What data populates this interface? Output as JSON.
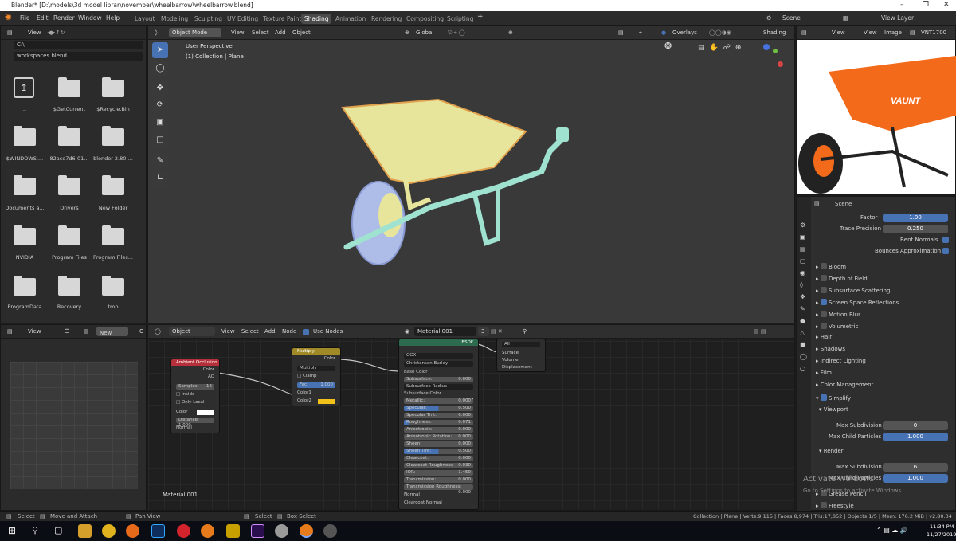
{
  "window": {
    "title": "Blender* [D:\\models\\3d model librar\\november\\wheelbarrow\\wheelbarrow.blend]"
  },
  "menu": [
    "File",
    "Edit",
    "Render",
    "Window",
    "Help"
  ],
  "workspaces": [
    "Layout",
    "Modeling",
    "Sculpting",
    "UV Editing",
    "Texture Paint",
    "Shading",
    "Animation",
    "Rendering",
    "Compositing",
    "Scripting"
  ],
  "active_workspace": "Shading",
  "scene": {
    "label": "Scene",
    "view_layer": "View Layer"
  },
  "filebrowser": {
    "view": "View",
    "path": "C:\\",
    "filename": "workspaces.blend",
    "items": [
      "..",
      "$GetCurrent",
      "$Recycle.Bin",
      "$WINDOWS....",
      "82ace7d6-01...",
      "blender-2.80-...",
      "Documents a...",
      "Drivers",
      "New Folder",
      "NVIDIA",
      "Program Files",
      "Program Files...",
      "ProgramData",
      "Recovery",
      "tmp"
    ]
  },
  "viewport": {
    "mode": "Object Mode",
    "menus": [
      "View",
      "Select",
      "Add",
      "Object"
    ],
    "orientation": "Global",
    "overlays": "Overlays",
    "shading": "Shading",
    "info_line1": "User Perspective",
    "info_line2": "(1) Collection | Plane"
  },
  "image_editor": {
    "view": "View",
    "view2": "View",
    "image": "Image",
    "name": "VNT1700",
    "brand": "VAUNT"
  },
  "properties": {
    "scene": "Scene",
    "factor_label": "Factor",
    "factor": "1.00",
    "trace_label": "Trace Precision",
    "trace": "0.250",
    "bent_normals": "Bent Normals",
    "bounces": "Bounces Approximation",
    "sections": [
      "Bloom",
      "Depth of Field",
      "Subsurface Scattering",
      "Screen Space Reflections",
      "Motion Blur",
      "Volumetric",
      "Hair",
      "Shadows",
      "Indirect Lighting",
      "Film",
      "Color Management",
      "Simplify"
    ],
    "viewport": "Viewport",
    "max_subdiv_label": "Max Subdivision",
    "max_subdiv_vp": "0",
    "max_child_label": "Max Child Particles",
    "max_child_vp": "1.000",
    "render": "Render",
    "max_subdiv_r": "6",
    "max_child_r": "1.000",
    "grease_pencil": "Grease Pencil",
    "freestyle": "Freestyle",
    "activate1": "Activate Windows",
    "activate2": "Go to Settings to activate Windows."
  },
  "image_panel": {
    "view": "View",
    "new": "New",
    "open": "O"
  },
  "node_editor": {
    "object": "Object",
    "menus": [
      "View",
      "Select",
      "Add",
      "Node"
    ],
    "use_nodes": "Use Nodes",
    "material": "Material.001",
    "users": "3",
    "material_label": "Material.001"
  },
  "nodes": {
    "ao": {
      "title": "Ambient Occlusion",
      "color": "Color",
      "ao": "AO",
      "samples": "Samples:",
      "samples_val": "16",
      "inside": "Inside",
      "only_local": "Only Local",
      "color_in": "Color",
      "distance": "Distance: 1.000",
      "normal": "Normal"
    },
    "multiply": {
      "title": "Multiply",
      "color": "Color",
      "mode": "Multiply",
      "clamp": "Clamp",
      "fac": "Fac",
      "fac_val": "1.000",
      "color1": "Color1",
      "color2": "Color2"
    },
    "bsdf": {
      "out": "BSDF",
      "dist": "GGX",
      "sss": "Christensen-Burley",
      "base_color": "Base Color",
      "rows": [
        [
          "Subsurface:",
          "0.000"
        ],
        [
          "Subsurface Radius",
          ""
        ],
        [
          "Subsurface Color",
          ""
        ],
        [
          "Metallic:",
          "0.000"
        ],
        [
          "Specular:",
          "0.500"
        ],
        [
          "Specular Tint:",
          "0.000"
        ],
        [
          "Roughness:",
          "0.071"
        ],
        [
          "Anisotropic:",
          "0.000"
        ],
        [
          "Anisotropic Rotation:",
          "0.000"
        ],
        [
          "Sheen:",
          "0.000"
        ],
        [
          "Sheen Tint:",
          "0.500"
        ],
        [
          "Clearcoat:",
          "0.000"
        ],
        [
          "Clearcoat Roughness:",
          "0.030"
        ],
        [
          "IOR:",
          "1.450"
        ],
        [
          "Transmission:",
          "0.000"
        ],
        [
          "Transmission Roughness:",
          "0.000"
        ]
      ],
      "normal": "Normal",
      "cc_normal": "Clearcoat Normal"
    },
    "output": {
      "target": "All",
      "surface": "Surface",
      "volume": "Volume",
      "displacement": "Displacement"
    }
  },
  "statusbar": {
    "select": "Select",
    "move": "Move and Attach",
    "pan": "Pan View",
    "select2": "Select",
    "box": "Box Select",
    "info": "Collection | Plane | Verts:9,115 | Faces:8,974 | Tris:17,852 | Objects:1/5 | Mem: 176.2 MiB | v2.80.34"
  },
  "taskbar": {
    "time": "11:34 PM",
    "date": "11/27/2019"
  },
  "colors": {
    "accent": "#4772b3",
    "wheelbarrow_tray": "#e8e8a0",
    "frame": "#9de3d0",
    "wheel": "#a8b8e8",
    "orange": "#f46a1b"
  }
}
